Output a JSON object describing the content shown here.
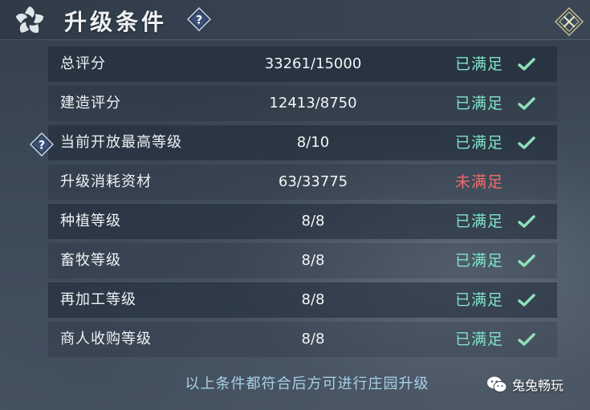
{
  "header": {
    "title": "升级条件"
  },
  "conditions": [
    {
      "label": "总评分",
      "value": "33261/15000",
      "status": "已满足",
      "met": true
    },
    {
      "label": "建造评分",
      "value": "12413/8750",
      "status": "已满足",
      "met": true
    },
    {
      "label": "当前开放最高等级",
      "value": "8/10",
      "status": "已满足",
      "met": true,
      "has_help": true
    },
    {
      "label": "升级消耗资材",
      "value": "63/33775",
      "status": "未满足",
      "met": false
    },
    {
      "label": "种植等级",
      "value": "8/8",
      "status": "已满足",
      "met": true
    },
    {
      "label": "畜牧等级",
      "value": "8/8",
      "status": "已满足",
      "met": true
    },
    {
      "label": "再加工等级",
      "value": "8/8",
      "status": "已满足",
      "met": true
    },
    {
      "label": "商人收购等级",
      "value": "8/8",
      "status": "已满足",
      "met": true
    }
  ],
  "footer": {
    "note": "以上条件都符合后方可进行庄园升级"
  },
  "watermark": {
    "text": "兔兔畅玩"
  },
  "colors": {
    "met": "#7fe3c8",
    "unmet": "#ef6c6c",
    "check": "#8ee0b8",
    "footer_text": "#a8d0e8"
  },
  "icons": {
    "logo": "spiral-emblem-icon",
    "help": "question-diamond-icon",
    "close": "close-diamond-icon",
    "check": "check-icon",
    "watermark": "wechat-icon"
  }
}
